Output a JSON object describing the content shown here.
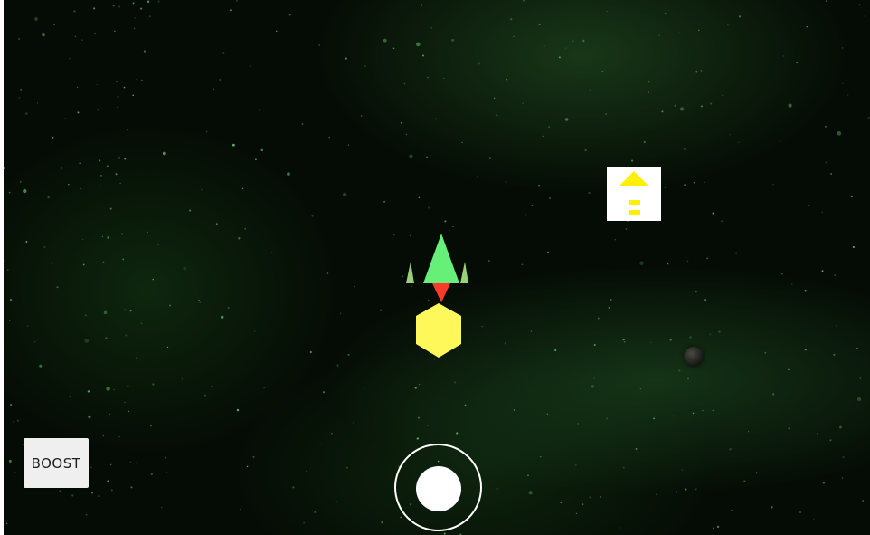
{
  "hud": {
    "boost_label": "BOOST"
  },
  "controls": {
    "joystick": "virtual-joystick"
  },
  "entities": {
    "player_ship": {
      "body_color": "#66f07a",
      "wing_color": "#9bd07a",
      "thruster_color": "#ff3b2a"
    },
    "fuel_orb": {
      "color": "#fff85a"
    },
    "powerup": {
      "background": "#ffffff",
      "icon_color": "#fff000",
      "icon": "arrow-up-icon"
    },
    "planet": {
      "color": "#3a3a36"
    }
  },
  "colors": {
    "space_background": "#050c05",
    "nebula": "#2e6a30",
    "button_background": "#efefef",
    "joystick": "#ffffff"
  }
}
